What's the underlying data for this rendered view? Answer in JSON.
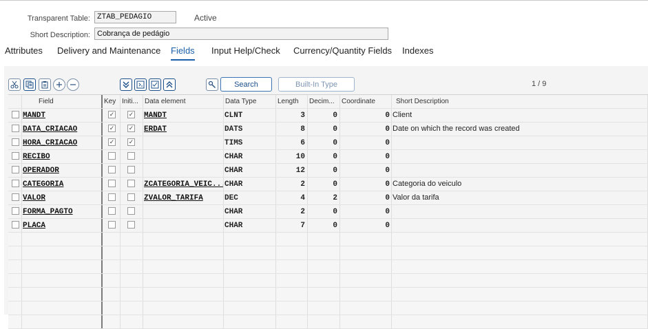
{
  "header": {
    "table_label": "Transparent Table:",
    "table_value": "ZTAB_PEDAGIO",
    "status": "Active",
    "desc_label": "Short Description:",
    "desc_value": "Cobrança de pedágio"
  },
  "tabs": [
    {
      "label": "Attributes",
      "active": false
    },
    {
      "label": "Delivery and Maintenance",
      "active": false
    },
    {
      "label": "Fields",
      "active": true
    },
    {
      "label": "Input Help/Check",
      "active": false
    },
    {
      "label": "Currency/Quantity Fields",
      "active": false
    },
    {
      "label": "Indexes",
      "active": false
    }
  ],
  "toolbar": {
    "search_label": "Search",
    "builtin_label": "Built-In Type",
    "pager": "1  /  9",
    "icons": [
      "cut-icon",
      "copy-icon",
      "paste-icon",
      "insert-row-icon",
      "delete-row-icon",
      "scroll-bottom-icon",
      "expand-icon",
      "collapse-icon",
      "scroll-top-icon",
      "key-icon"
    ]
  },
  "grid": {
    "columns": [
      "Field",
      "Key",
      "Initi...",
      "Data element",
      "Data Type",
      "Length",
      "Decim...",
      "Coordinate",
      "Short Description"
    ],
    "rows": [
      {
        "field": "MANDT",
        "key": true,
        "init": true,
        "data_element": "MANDT",
        "data_type": "CLNT",
        "length": "3",
        "decimals": "0",
        "coordinate": "0",
        "description": "Client"
      },
      {
        "field": "DATA_CRIACAO",
        "key": true,
        "init": true,
        "data_element": "ERDAT",
        "data_type": "DATS",
        "length": "8",
        "decimals": "0",
        "coordinate": "0",
        "description": "Date on which the record was created"
      },
      {
        "field": "HORA_CRIACAO",
        "key": true,
        "init": true,
        "data_element": "",
        "data_type": "TIMS",
        "length": "6",
        "decimals": "0",
        "coordinate": "0",
        "description": ""
      },
      {
        "field": "RECIBO",
        "key": false,
        "init": false,
        "data_element": "",
        "data_type": "CHAR",
        "length": "10",
        "decimals": "0",
        "coordinate": "0",
        "description": ""
      },
      {
        "field": "OPERADOR",
        "key": false,
        "init": false,
        "data_element": "",
        "data_type": "CHAR",
        "length": "12",
        "decimals": "0",
        "coordinate": "0",
        "description": ""
      },
      {
        "field": "CATEGORIA",
        "key": false,
        "init": false,
        "data_element": "ZCATEGORIA_VEIC...",
        "data_type": "CHAR",
        "length": "2",
        "decimals": "0",
        "coordinate": "0",
        "description": "Categoria do veiculo"
      },
      {
        "field": "VALOR",
        "key": false,
        "init": false,
        "data_element": "ZVALOR_TARIFA",
        "data_type": "DEC",
        "length": "4",
        "decimals": "2",
        "coordinate": "0",
        "description": "Valor da tarifa"
      },
      {
        "field": "FORMA_PAGTO",
        "key": false,
        "init": false,
        "data_element": "",
        "data_type": "CHAR",
        "length": "2",
        "decimals": "0",
        "coordinate": "0",
        "description": ""
      },
      {
        "field": "PLACA",
        "key": false,
        "init": false,
        "data_element": "",
        "data_type": "CHAR",
        "length": "7",
        "decimals": "0",
        "coordinate": "0",
        "description": ""
      }
    ]
  }
}
